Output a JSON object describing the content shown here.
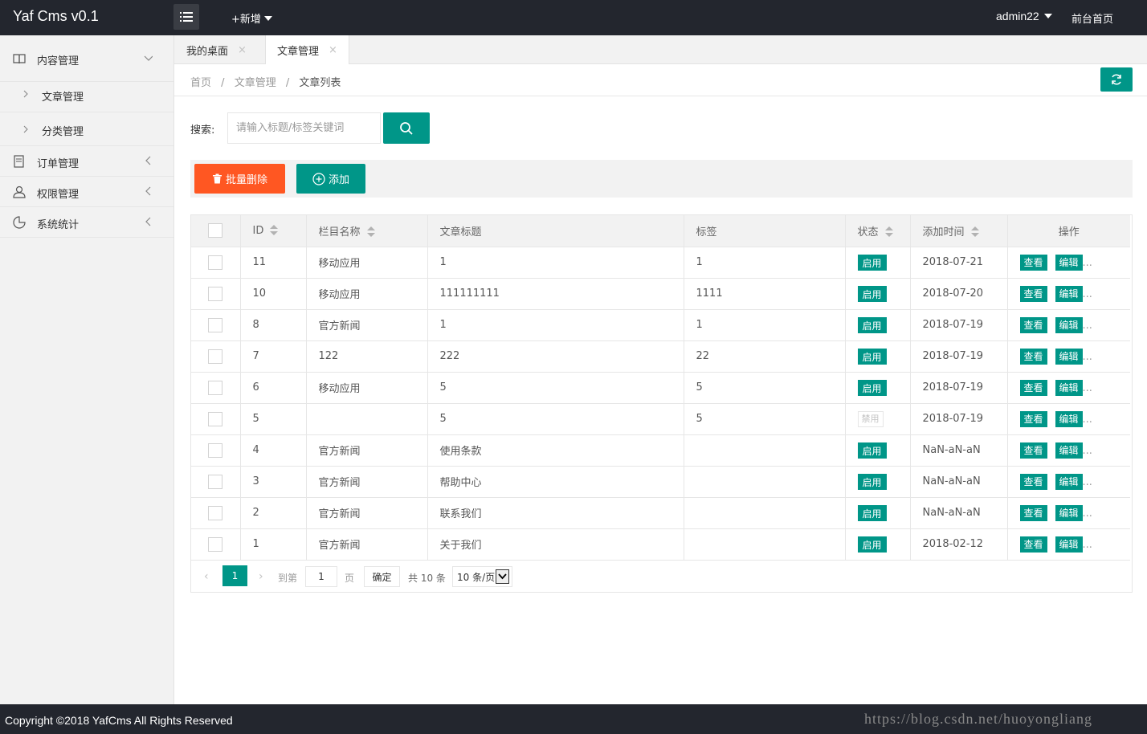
{
  "header": {
    "logo": "Yaf Cms v0.1",
    "new_label": "+新增",
    "user": "admin22",
    "front_link": "前台首页"
  },
  "sidebar": {
    "content": "内容管理",
    "sub_article": "文章管理",
    "sub_category": "分类管理",
    "orders": "订单管理",
    "permissions": "权限管理",
    "stats": "系统统计"
  },
  "tabs": {
    "desktop": "我的桌面",
    "articles": "文章管理",
    "close": "×"
  },
  "breadcrumb": {
    "home": "首页",
    "section": "文章管理",
    "current": "文章列表",
    "sep": "/"
  },
  "search": {
    "label": "搜索:",
    "placeholder": "请输入标题/标签关键词"
  },
  "toolbar": {
    "batch_delete": "批量删除",
    "add": "添加"
  },
  "table": {
    "headers": {
      "id": "ID",
      "column": "栏目名称",
      "title": "文章标题",
      "tags": "标签",
      "status": "状态",
      "time": "添加时间",
      "ops": "操作"
    },
    "view_label": "查看",
    "edit_label": "编辑",
    "more": "...",
    "rows": [
      {
        "id": "11",
        "column": "移动应用",
        "title": "1",
        "tags": "1",
        "status": "启用",
        "enabled": true,
        "time": "2018-07-21"
      },
      {
        "id": "10",
        "column": "移动应用",
        "title": "111111111",
        "tags": "1111",
        "status": "启用",
        "enabled": true,
        "time": "2018-07-20"
      },
      {
        "id": "8",
        "column": "官方新闻",
        "title": "1",
        "tags": "1",
        "status": "启用",
        "enabled": true,
        "time": "2018-07-19"
      },
      {
        "id": "7",
        "column": "122",
        "title": "222",
        "tags": "22",
        "status": "启用",
        "enabled": true,
        "time": "2018-07-19"
      },
      {
        "id": "6",
        "column": "移动应用",
        "title": "5",
        "tags": "5",
        "status": "启用",
        "enabled": true,
        "time": "2018-07-19"
      },
      {
        "id": "5",
        "column": "",
        "title": "5",
        "tags": "5",
        "status": "禁用",
        "enabled": false,
        "time": "2018-07-19"
      },
      {
        "id": "4",
        "column": "官方新闻",
        "title": "使用条款",
        "tags": "",
        "status": "启用",
        "enabled": true,
        "time": "NaN-aN-aN"
      },
      {
        "id": "3",
        "column": "官方新闻",
        "title": "帮助中心",
        "tags": "",
        "status": "启用",
        "enabled": true,
        "time": "NaN-aN-aN"
      },
      {
        "id": "2",
        "column": "官方新闻",
        "title": "联系我们",
        "tags": "",
        "status": "启用",
        "enabled": true,
        "time": "NaN-aN-aN"
      },
      {
        "id": "1",
        "column": "官方新闻",
        "title": "关于我们",
        "tags": "",
        "status": "启用",
        "enabled": true,
        "time": "2018-02-12"
      }
    ]
  },
  "pager": {
    "current": "1",
    "goto_label": "到第",
    "goto_value": "1",
    "page_label": "页",
    "confirm": "确定",
    "total": "共 10 条",
    "page_size": "10 条/页"
  },
  "footer": {
    "copyright": "Copyright ©2018 YafCms All Rights Reserved",
    "watermark": "https://blog.csdn.net/huoyongliang"
  },
  "colors": {
    "header_bg": "#23262e",
    "accent": "#009688",
    "danger": "#ff5722"
  }
}
